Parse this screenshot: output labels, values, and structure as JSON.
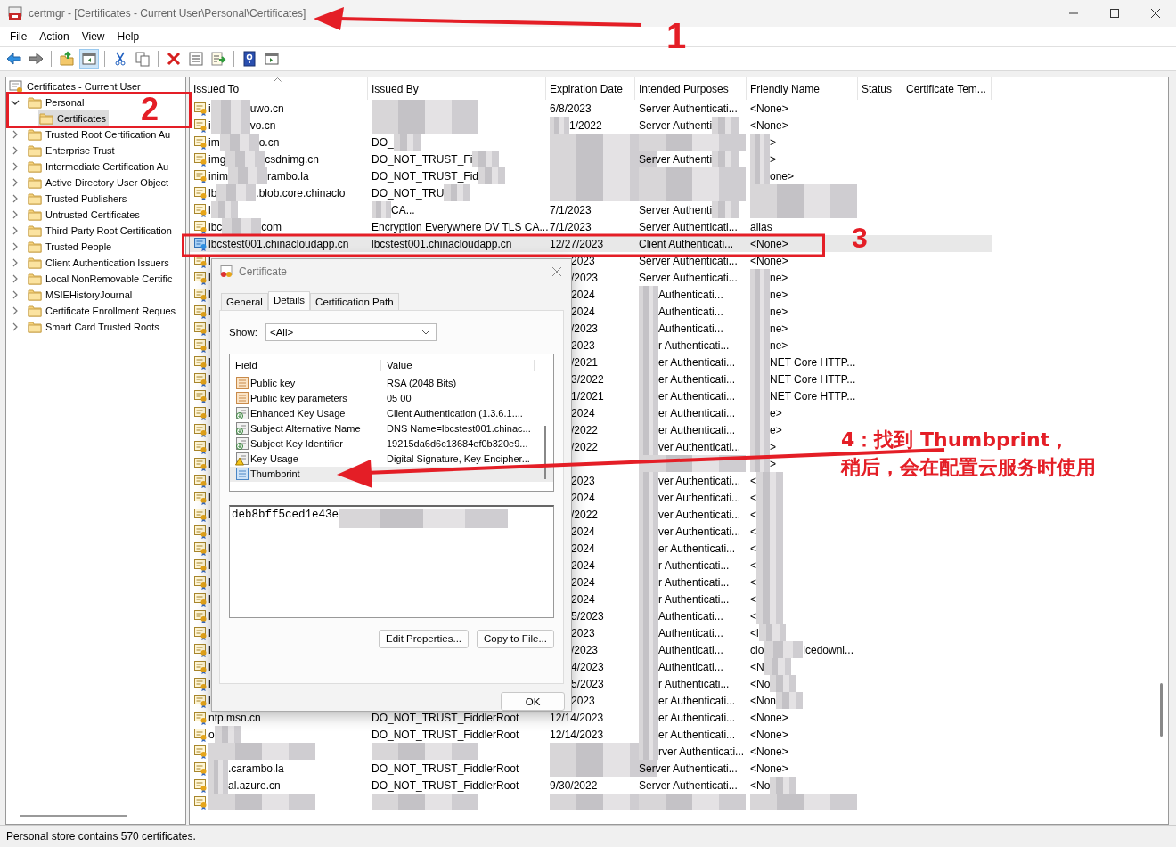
{
  "window": {
    "title": "certmgr - [Certificates - Current User\\Personal\\Certificates]"
  },
  "menu": [
    "File",
    "Action",
    "View",
    "Help"
  ],
  "toolbar": [
    {
      "kind": "back",
      "pressed": false
    },
    {
      "kind": "forward",
      "pressed": false
    },
    {
      "kind": "sep"
    },
    {
      "kind": "up",
      "pressed": false
    },
    {
      "kind": "tree",
      "pressed": true
    },
    {
      "kind": "sep"
    },
    {
      "kind": "cut",
      "pressed": false
    },
    {
      "kind": "copy",
      "pressed": false
    },
    {
      "kind": "sep"
    },
    {
      "kind": "delete",
      "pressed": false
    },
    {
      "kind": "properties",
      "pressed": false
    },
    {
      "kind": "export",
      "pressed": false
    },
    {
      "kind": "sep"
    },
    {
      "kind": "help",
      "pressed": false
    },
    {
      "kind": "console",
      "pressed": false
    }
  ],
  "tree": {
    "root": "Certificates - Current User",
    "items": [
      {
        "label": "Personal",
        "expanded": true,
        "selected": false,
        "children": [
          {
            "label": "Certificates",
            "selected": true
          }
        ]
      },
      {
        "label": "Trusted Root Certification Au",
        "expanded": false,
        "selected": false
      },
      {
        "label": "Enterprise Trust",
        "expanded": false,
        "selected": false
      },
      {
        "label": "Intermediate Certification Au",
        "expanded": false,
        "selected": false
      },
      {
        "label": "Active Directory User Object",
        "expanded": false,
        "selected": false
      },
      {
        "label": "Trusted Publishers",
        "expanded": false,
        "selected": false
      },
      {
        "label": "Untrusted Certificates",
        "expanded": false,
        "selected": false
      },
      {
        "label": "Third-Party Root Certification",
        "expanded": false,
        "selected": false
      },
      {
        "label": "Trusted People",
        "expanded": false,
        "selected": false
      },
      {
        "label": "Client Authentication Issuers",
        "expanded": false,
        "selected": false
      },
      {
        "label": "Local NonRemovable Certific",
        "expanded": false,
        "selected": false
      },
      {
        "label": "MSIEHistoryJournal",
        "expanded": false,
        "selected": false
      },
      {
        "label": "Certificate Enrollment Reques",
        "expanded": false,
        "selected": false
      },
      {
        "label": "Smart Card Trusted Roots",
        "expanded": false,
        "selected": false
      }
    ]
  },
  "table": {
    "columns": [
      {
        "label": "Issued To",
        "sorted": true
      },
      {
        "label": "Issued By",
        "sorted": false
      },
      {
        "label": "Expiration Date",
        "sorted": false
      },
      {
        "label": "Intended Purposes",
        "sorted": false
      },
      {
        "label": "Friendly Name",
        "sorted": false
      },
      {
        "label": "Status",
        "sorted": false
      },
      {
        "label": "Certificate Tem...",
        "sorted": false
      }
    ],
    "rows": [
      {
        "selected": false,
        "cells": [
          {
            "before": "i",
            "redacted": true,
            "after": "uwo.cn"
          },
          {
            "redacted": true
          },
          {
            "text": "6/8/2023"
          },
          {
            "text": "Server Authenticati..."
          },
          {
            "text": "<None>"
          }
        ]
      },
      {
        "selected": false,
        "cells": [
          {
            "before": "i",
            "redacted": true,
            "after": "vo.cn"
          },
          {
            "redacted": true
          },
          {
            "redacted": true,
            "after": "1/2022"
          },
          {
            "before": "Server Authenti",
            "redacted": true
          },
          {
            "text": "<None>"
          }
        ]
      },
      {
        "selected": false,
        "cells": [
          {
            "before": "im",
            "redacted": true,
            "after": "o.cn"
          },
          {
            "before": "DO_",
            "redacted": true
          },
          {
            "redacted": true
          },
          {
            "redacted": true
          },
          {
            "redacted": true,
            "after": ">"
          }
        ]
      },
      {
        "selected": false,
        "cells": [
          {
            "before": "img",
            "redacted": true,
            "after": "csdnimg.cn"
          },
          {
            "before": "DO_NOT_TRUST_Fi",
            "redacted": true
          },
          {
            "redacted": true
          },
          {
            "before": "Server Authenti",
            "redacted": true
          },
          {
            "redacted": true,
            "after": ">"
          }
        ]
      },
      {
        "selected": false,
        "cells": [
          {
            "before": "inim",
            "redacted": true,
            "after": "rambo.la"
          },
          {
            "before": "DO_NOT_TRUST_Fid",
            "redacted": true
          },
          {
            "redacted": true
          },
          {
            "redacted": true
          },
          {
            "redacted": true,
            "after": "one>"
          }
        ]
      },
      {
        "selected": false,
        "cells": [
          {
            "before": "lb",
            "redacted": true,
            "after": ".blob.core.chinaclo"
          },
          {
            "before": "DO_NOT_TRU",
            "redacted": true
          },
          {
            "redacted": true
          },
          {
            "redacted": true
          },
          {
            "redacted": true
          }
        ]
      },
      {
        "selected": false,
        "cells": [
          {
            "before": "l",
            "redacted": true
          },
          {
            "redacted": true,
            "after": "CA..."
          },
          {
            "text": "7/1/2023"
          },
          {
            "before": "Server Authenti",
            "redacted": true
          },
          {
            "redacted": true
          }
        ]
      },
      {
        "selected": false,
        "cells": [
          {
            "before": "lbc",
            "redacted": true,
            "after": "com"
          },
          {
            "text": "Encryption Everywhere DV TLS CA..."
          },
          {
            "text": "7/1/2023"
          },
          {
            "text": "Server Authenticati..."
          },
          {
            "text": "alias"
          }
        ]
      },
      {
        "selected": true,
        "cells": [
          {
            "text": "lbcstest001.chinacloudapp.cn"
          },
          {
            "text": "lbcstest001.chinacloudapp.cn"
          },
          {
            "text": "12/27/2023"
          },
          {
            "text": "Client Authenticati..."
          },
          {
            "text": "<None>"
          }
        ]
      },
      {
        "selected": false,
        "cells": [
          {
            "text": "l"
          },
          null,
          {
            "covered": true,
            "text": "2023"
          },
          {
            "text": "Server Authenticati..."
          },
          {
            "text": "<None>"
          }
        ]
      },
      {
        "selected": false,
        "cells": [
          {
            "text": "l"
          },
          null,
          {
            "covered": true,
            "text": "/2023"
          },
          {
            "text": "Server Authenticati..."
          },
          {
            "redacted": true,
            "after": "ne>"
          }
        ]
      },
      {
        "selected": false,
        "cells": [
          {
            "text": "l"
          },
          null,
          {
            "covered": true,
            "text": "2024"
          },
          {
            "redacted": true,
            "after": "Authenticati..."
          },
          {
            "redacted": true,
            "after": "ne>"
          }
        ]
      },
      {
        "selected": false,
        "cells": [
          {
            "text": "l"
          },
          null,
          {
            "covered": true,
            "text": "2024"
          },
          {
            "redacted": true,
            "after": "Authenticati..."
          },
          {
            "redacted": true,
            "after": "ne>"
          }
        ]
      },
      {
        "selected": false,
        "cells": [
          {
            "text": "l"
          },
          null,
          {
            "covered": true,
            "text": "/2023"
          },
          {
            "redacted": true,
            "after": "Authenticati..."
          },
          {
            "redacted": true,
            "after": "ne>"
          }
        ]
      },
      {
        "selected": false,
        "cells": [
          {
            "text": "l"
          },
          null,
          {
            "covered": true,
            "text": "2023"
          },
          {
            "redacted": true,
            "after": "r Authenticati..."
          },
          {
            "redacted": true,
            "after": "ne>"
          }
        ]
      },
      {
        "selected": false,
        "cells": [
          {
            "text": "l"
          },
          null,
          {
            "covered": true,
            "text": "/2021"
          },
          {
            "redacted": true,
            "after": "er Authenticati..."
          },
          {
            "redacted": true,
            "after": "NET Core HTTP..."
          }
        ]
      },
      {
        "selected": false,
        "cells": [
          {
            "text": "l"
          },
          null,
          {
            "covered": true,
            "text": "3/2022"
          },
          {
            "redacted": true,
            "after": "er Authenticati..."
          },
          {
            "redacted": true,
            "after": "NET Core HTTP..."
          }
        ]
      },
      {
        "selected": false,
        "cells": [
          {
            "text": "l"
          },
          null,
          {
            "covered": true,
            "text": "1/2021"
          },
          {
            "redacted": true,
            "after": "er Authenticati..."
          },
          {
            "redacted": true,
            "after": "NET Core HTTP..."
          }
        ]
      },
      {
        "selected": false,
        "cells": [
          {
            "text": "l"
          },
          null,
          {
            "covered": true,
            "text": "2024"
          },
          {
            "redacted": true,
            "after": "er Authenticati..."
          },
          {
            "redacted": true,
            "after": "e>"
          }
        ]
      },
      {
        "selected": false,
        "cells": [
          {
            "text": "l"
          },
          null,
          {
            "covered": true,
            "text": "/2022"
          },
          {
            "redacted": true,
            "after": "er Authenticati..."
          },
          {
            "redacted": true,
            "after": "e>"
          }
        ]
      },
      {
        "selected": false,
        "cells": [
          {
            "text": "l"
          },
          null,
          {
            "covered": true,
            "text": "/2022"
          },
          {
            "redacted": true,
            "after": "ver Authenticati..."
          },
          {
            "redacted": true,
            "after": ">"
          }
        ]
      },
      {
        "selected": false,
        "cells": [
          {
            "text": "l"
          },
          null,
          null,
          {
            "redacted": true
          },
          {
            "redacted": true,
            "after": ">"
          }
        ]
      },
      {
        "selected": false,
        "cells": [
          {
            "text": "l"
          },
          null,
          {
            "covered": true,
            "text": "2023"
          },
          {
            "redacted": true,
            "after": "ver Authenticati..."
          },
          {
            "before": "<",
            "redacted": true
          }
        ]
      },
      {
        "selected": false,
        "cells": [
          {
            "text": "l"
          },
          null,
          {
            "covered": true,
            "text": "2024"
          },
          {
            "redacted": true,
            "after": "ver Authenticati..."
          },
          {
            "before": "<",
            "redacted": true
          }
        ]
      },
      {
        "selected": false,
        "cells": [
          {
            "text": "l"
          },
          null,
          {
            "covered": true,
            "text": "/2022"
          },
          {
            "redacted": true,
            "after": "ver Authenticati..."
          },
          {
            "before": "<",
            "redacted": true
          }
        ]
      },
      {
        "selected": false,
        "cells": [
          {
            "text": "l"
          },
          null,
          {
            "covered": true,
            "text": "2024"
          },
          {
            "redacted": true,
            "after": "ver Authenticati..."
          },
          {
            "before": "<",
            "redacted": true
          }
        ]
      },
      {
        "selected": false,
        "cells": [
          {
            "text": "l"
          },
          null,
          {
            "covered": true,
            "text": "2024"
          },
          {
            "redacted": true,
            "after": "er Authenticati..."
          },
          {
            "before": "<",
            "redacted": true
          }
        ]
      },
      {
        "selected": false,
        "cells": [
          {
            "text": "l"
          },
          null,
          {
            "covered": true,
            "text": "2024"
          },
          {
            "redacted": true,
            "after": "r Authenticati..."
          },
          {
            "before": "<",
            "redacted": true
          }
        ]
      },
      {
        "selected": false,
        "cells": [
          {
            "text": "l"
          },
          null,
          {
            "covered": true,
            "text": "2024"
          },
          {
            "redacted": true,
            "after": "r Authenticati..."
          },
          {
            "before": "<",
            "redacted": true
          }
        ]
      },
      {
        "selected": false,
        "cells": [
          {
            "text": "l"
          },
          null,
          {
            "covered": true,
            "text": "2024"
          },
          {
            "redacted": true,
            "after": "r Authenticati..."
          },
          {
            "before": "<",
            "redacted": true
          }
        ]
      },
      {
        "selected": false,
        "cells": [
          {
            "text": "l"
          },
          null,
          {
            "covered": true,
            "text": "5/2023"
          },
          {
            "redacted": true,
            "after": "Authenticati..."
          },
          {
            "before": "<",
            "redacted": true
          }
        ]
      },
      {
        "selected": false,
        "cells": [
          {
            "text": "l"
          },
          null,
          {
            "covered": true,
            "text": "2023"
          },
          {
            "redacted": true,
            "after": "Authenticati..."
          },
          {
            "before": "<l",
            "redacted": true
          }
        ]
      },
      {
        "selected": false,
        "cells": [
          {
            "text": "l"
          },
          null,
          {
            "covered": true,
            "text": "/2023"
          },
          {
            "redacted": true,
            "after": "Authenticati..."
          },
          {
            "before": "clo",
            "redacted": true,
            "after": "icedownl..."
          }
        ]
      },
      {
        "selected": false,
        "cells": [
          {
            "text": "l"
          },
          null,
          {
            "covered": true,
            "text": "4/2023"
          },
          {
            "redacted": true,
            "after": "Authenticati..."
          },
          {
            "before": "<N",
            "redacted": true
          }
        ]
      },
      {
        "selected": false,
        "cells": [
          {
            "text": "l"
          },
          null,
          {
            "covered": true,
            "text": "5/2023"
          },
          {
            "redacted": true,
            "after": "r Authenticati..."
          },
          {
            "before": "<No",
            "redacted": true
          }
        ]
      },
      {
        "selected": false,
        "cells": [
          {
            "text": "l"
          },
          null,
          {
            "covered": true,
            "text": "2023"
          },
          {
            "redacted": true,
            "after": "er Authenticati..."
          },
          {
            "before": "<Non",
            "redacted": true
          }
        ]
      },
      {
        "selected": false,
        "cells": [
          {
            "text": "ntp.msn.cn"
          },
          {
            "text": "DO_NOT_TRUST_FiddlerRoot"
          },
          {
            "text": "12/14/2023"
          },
          {
            "redacted": true,
            "after": "er Authenticati..."
          },
          {
            "text": "<None>"
          }
        ]
      },
      {
        "selected": false,
        "cells": [
          {
            "before": "o",
            "redacted": true
          },
          {
            "text": "DO_NOT_TRUST_FiddlerRoot"
          },
          {
            "text": "12/14/2023"
          },
          {
            "redacted": true,
            "after": "er Authenticati..."
          },
          {
            "text": "<None>"
          }
        ]
      },
      {
        "selected": false,
        "cells": [
          {
            "redacted": true
          },
          {
            "redacted": true
          },
          {
            "redacted": true
          },
          {
            "redacted": true,
            "after": "rver Authenticati..."
          },
          {
            "text": "<None>"
          }
        ]
      },
      {
        "selected": false,
        "cells": [
          {
            "redacted": true,
            "after": ".carambo.la"
          },
          {
            "text": "DO_NOT_TRUST_FiddlerRoot"
          },
          {
            "redacted": true
          },
          {
            "text": "Server Authenticati..."
          },
          {
            "text": "<None>"
          }
        ]
      },
      {
        "selected": false,
        "cells": [
          {
            "redacted": true,
            "after": "al.azure.cn"
          },
          {
            "text": "DO_NOT_TRUST_FiddlerRoot"
          },
          {
            "text": "9/30/2022"
          },
          {
            "text": "Server Authenticati..."
          },
          {
            "before": "<No",
            "redacted": true
          }
        ]
      },
      {
        "selected": false,
        "cells": [
          {
            "redacted": true
          },
          {
            "redacted": true
          },
          {
            "redacted": true
          },
          {
            "redacted": true
          },
          {
            "redacted": true
          }
        ]
      }
    ]
  },
  "status_bar": "Personal store contains 570 certificates.",
  "dialog": {
    "title": "Certificate",
    "tabs": [
      {
        "label": "General",
        "selected": false
      },
      {
        "label": "Details",
        "selected": true
      },
      {
        "label": "Certification Path",
        "selected": false
      }
    ],
    "show_label": "Show:",
    "show_value": "<All>",
    "list_columns": [
      "Field",
      "Value"
    ],
    "fields": [
      {
        "kind": "property",
        "field": "Public key",
        "value": "RSA (2048 Bits)",
        "selected": false
      },
      {
        "kind": "property",
        "field": "Public key parameters",
        "value": "05 00",
        "selected": false
      },
      {
        "kind": "extension",
        "field": "Enhanced Key Usage",
        "value": "Client Authentication (1.3.6.1....",
        "selected": false
      },
      {
        "kind": "extension",
        "field": "Subject Alternative Name",
        "value": "DNS Name=lbcstest001.chinac...",
        "selected": false
      },
      {
        "kind": "extension",
        "field": "Subject Key Identifier",
        "value": "19215da6d6c13684ef0b320e9...",
        "selected": false
      },
      {
        "kind": "critical",
        "field": "Key Usage",
        "value": "Digital Signature, Key Encipher...",
        "selected": false
      },
      {
        "kind": "thumbprint",
        "field": "Thumbprint",
        "selected": true
      }
    ],
    "detail_text": "deb8bff5ced1e43e",
    "detail_redacted": true,
    "buttons": [
      "Edit Properties...",
      "Copy to File..."
    ],
    "ok": "OK"
  },
  "annotations": {
    "numbers": [
      "1",
      "2",
      "3"
    ],
    "note": [
      "4：找到 Thumbprint，",
      "稍后，会在配置云服务时使用"
    ]
  }
}
